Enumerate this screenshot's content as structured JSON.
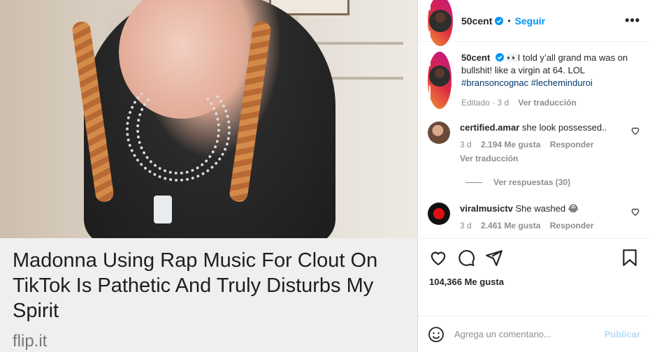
{
  "media": {
    "headline": "Madonna Using Rap Music For Clout On TikTok Is Pathetic And Truly Disturbs My Spirit",
    "source": "flip.it"
  },
  "header": {
    "username": "50cent",
    "separator": "•",
    "follow_label": "Seguir",
    "more_label": "•••"
  },
  "caption": {
    "username": "50cent",
    "emoji": "👀",
    "text": "I told y’all grand ma was on bullshit! like a virgin at 64. LOL",
    "tags": [
      "#bransoncognac",
      "#lecheminduroi"
    ],
    "edited": "Editado · 3 d",
    "see_translation": "Ver traducción"
  },
  "comments": [
    {
      "username": "certified.amar",
      "text": "she look possessed..",
      "time": "3 d",
      "likes": "2.194 Me gusta",
      "reply": "Responder",
      "see_translation": "Ver traducción"
    },
    {
      "username": "viralmusictv",
      "text": "She washed 😂",
      "time": "3 d",
      "likes": "2.461 Me gusta",
      "reply": "Responder"
    }
  ],
  "replies_label": "Ver respuestas (30)",
  "likes_count": "104,366 Me gusta",
  "add_comment": {
    "placeholder": "Agrega un comentario...",
    "publish_label": "Publicar"
  },
  "colors": {
    "link_blue": "#0095f6",
    "hashtag": "#00376b",
    "publish_disabled": "#b2dffc",
    "meta_gray": "#8e8e8e"
  }
}
